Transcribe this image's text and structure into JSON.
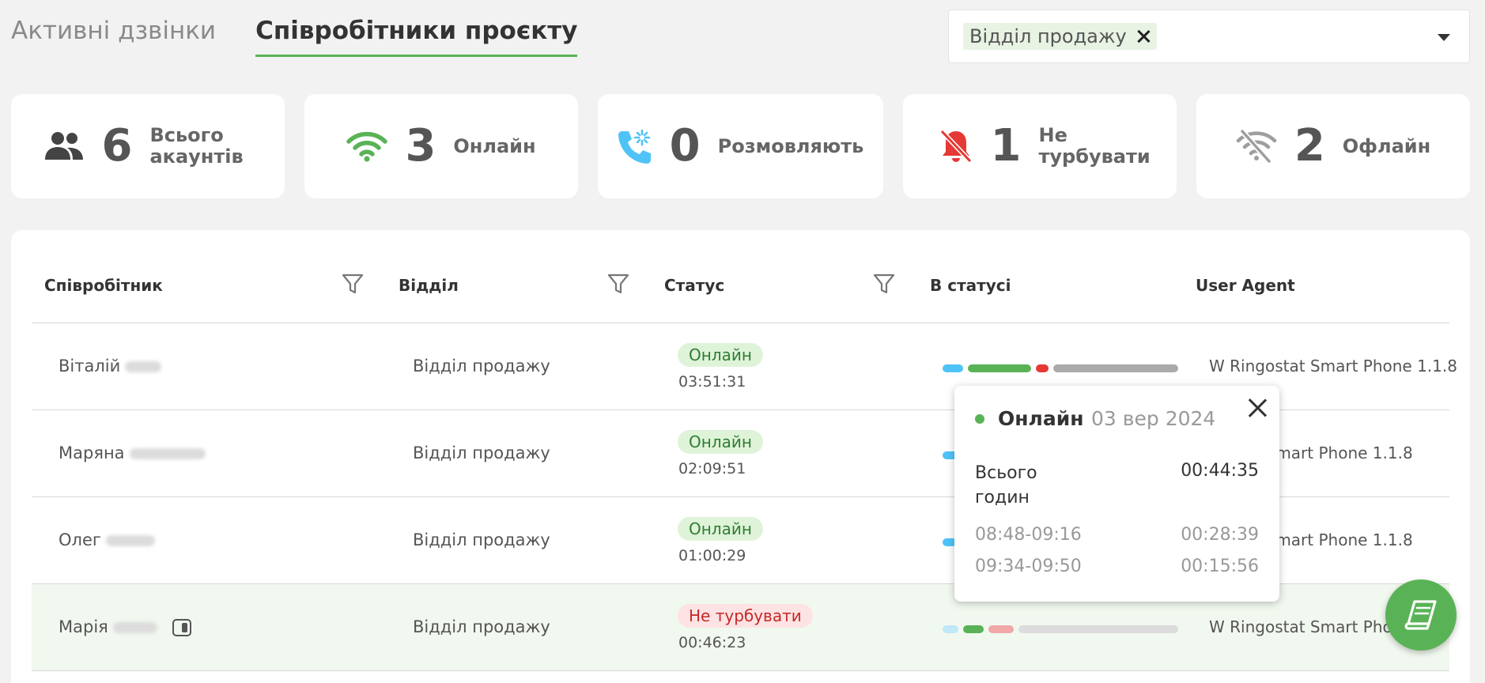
{
  "tabs": [
    {
      "label": "Активні дзвінки"
    },
    {
      "label": "Співробітники проєкту"
    }
  ],
  "filter": {
    "chip": "Відділ продажу"
  },
  "stats": {
    "total": {
      "value": "6",
      "label": "Всього акаунтів"
    },
    "online": {
      "value": "3",
      "label": "Онлайн"
    },
    "talking": {
      "value": "0",
      "label": "Розмовляють"
    },
    "dnd": {
      "value": "1",
      "label": "Не турбувати"
    },
    "offline": {
      "value": "2",
      "label": "Офлайн"
    }
  },
  "table": {
    "headers": {
      "employee": "Співробітник",
      "department": "Відділ",
      "status": "Статус",
      "in_status": "В статусі",
      "user_agent": "User Agent"
    },
    "rows": [
      {
        "name": "Віталій",
        "department": "Відділ продажу",
        "status": "Онлайн",
        "time": "03:51:31",
        "user_agent": "W Ringostat Smart Phone 1.1.8"
      },
      {
        "name": "Маряна",
        "department": "Відділ продажу",
        "status": "Онлайн",
        "time": "02:09:51",
        "user_agent": "st Smart Phone 1.1.8"
      },
      {
        "name": "Олег",
        "department": "Відділ продажу",
        "status": "Онлайн",
        "time": "01:00:29",
        "user_agent": "st Smart Phone 1.1.8"
      },
      {
        "name": "Марія",
        "department": "Відділ продажу",
        "status": "Не турбувати",
        "time": "00:46:23",
        "user_agent": "W Ringostat Smart Phone"
      }
    ]
  },
  "popup": {
    "title": "Онлайн",
    "date": "03 вер 2024",
    "total_label": "Всього годин",
    "total_value": "00:44:35",
    "intervals": [
      {
        "range": "08:48-09:16",
        "duration": "00:28:39"
      },
      {
        "range": "09:34-09:50",
        "duration": "00:15:56"
      }
    ]
  },
  "colors": {
    "accent": "#59b356",
    "online": "#59b356",
    "talking": "#4fc3f7",
    "dnd": "#e53935",
    "offline": "#9e9e9e"
  }
}
